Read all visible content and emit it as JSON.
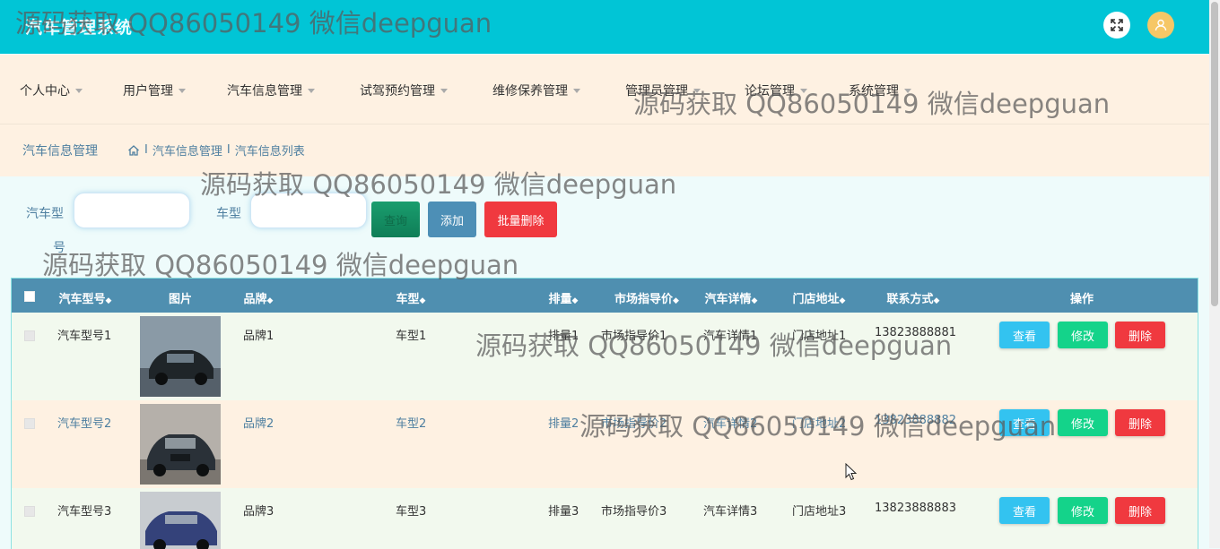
{
  "app": {
    "title": "汽车管理系统"
  },
  "nav": [
    {
      "label": "个人中心"
    },
    {
      "label": "用户管理"
    },
    {
      "label": "汽车信息管理"
    },
    {
      "label": "试驾预约管理"
    },
    {
      "label": "维修保养管理"
    },
    {
      "label": "管理员管理"
    },
    {
      "label": "论坛管理"
    },
    {
      "label": "系统管理"
    }
  ],
  "breadcrumb": {
    "title": "汽车信息管理",
    "path1": "汽车信息管理",
    "path2": "汽车信息列表",
    "sep": "I"
  },
  "search": {
    "model_label_1": "汽车型",
    "model_label_2": "号",
    "type_label": "车型",
    "model_value": "",
    "type_value": "",
    "query_button": "查询",
    "add_button": "添加",
    "bulk_delete_button": "批量删除"
  },
  "table": {
    "headers": {
      "model": "汽车型号",
      "image": "图片",
      "brand": "品牌",
      "type": "车型",
      "displacement": "排量",
      "price": "市场指导价",
      "detail": "汽车详情",
      "address": "门店地址",
      "contact": "联系方式",
      "action": "操作"
    },
    "sort_glyph": "◆",
    "rows": [
      {
        "model": "汽车型号1",
        "brand": "品牌1",
        "type": "车型1",
        "displacement": "排量1",
        "price": "市场指导价1",
        "detail": "汽车详情1",
        "address": "门店地址1",
        "contact": "13823888881"
      },
      {
        "model": "汽车型号2",
        "brand": "品牌2",
        "type": "车型2",
        "displacement": "排量2",
        "price": "市场指导价2",
        "detail": "汽车详情2",
        "address": "门店地址2",
        "contact": "13823888882"
      },
      {
        "model": "汽车型号3",
        "brand": "品牌3",
        "type": "车型3",
        "displacement": "排量3",
        "price": "市场指导价3",
        "detail": "汽车详情3",
        "address": "门店地址3",
        "contact": "13823888883"
      }
    ],
    "actions": {
      "view": "查看",
      "edit": "修改",
      "delete": "删除"
    }
  },
  "watermark": "源码获取 QQ86050149 微信deepguan",
  "colors": {
    "header": "#01c5d6",
    "nav_bg": "#fef1e2",
    "table_head": "#4f8fb0",
    "view": "#33c3f0",
    "edit": "#14d38a",
    "delete": "#f0393f"
  }
}
